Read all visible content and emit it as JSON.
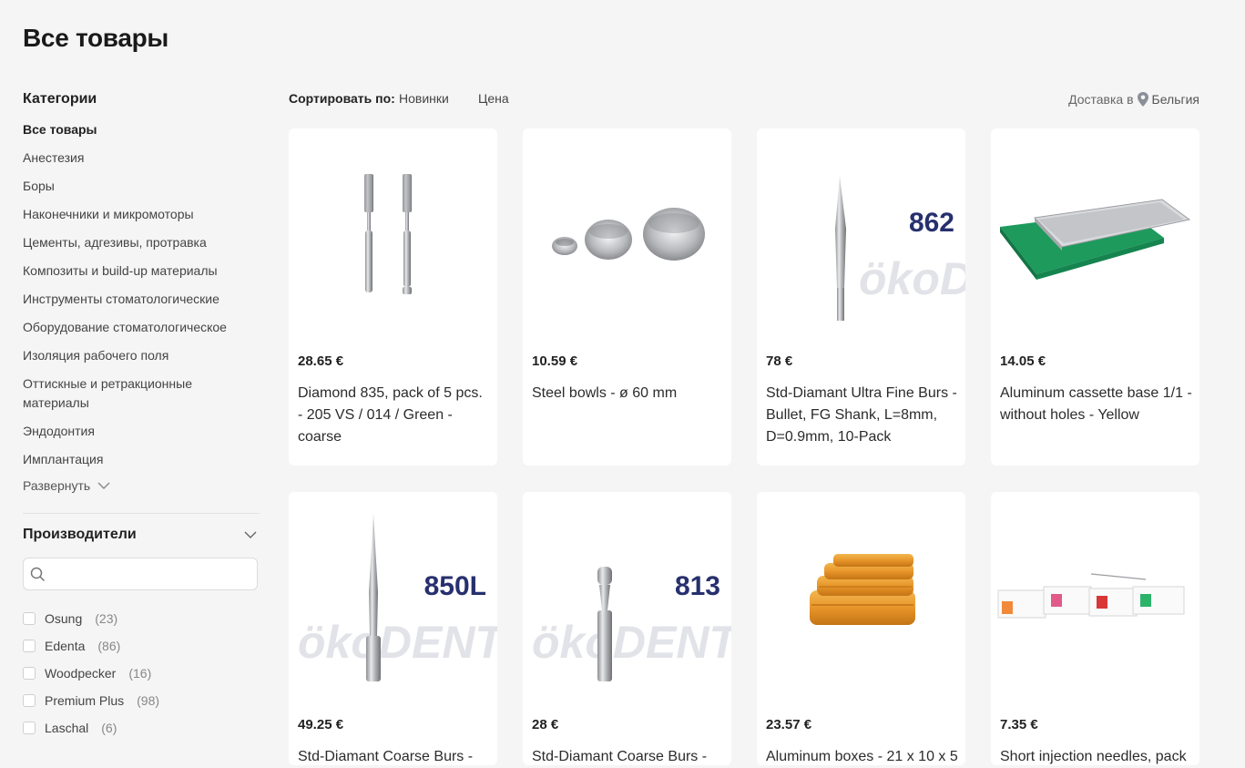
{
  "page": {
    "title": "Все товары"
  },
  "sidebar": {
    "categories_title": "Категории",
    "categories": [
      {
        "label": "Все товары",
        "active": true
      },
      {
        "label": "Анестезия"
      },
      {
        "label": "Боры"
      },
      {
        "label": "Наконечники и микромоторы"
      },
      {
        "label": "Цементы, адгезивы, протравка"
      },
      {
        "label": "Композиты и build-up материалы"
      },
      {
        "label": "Инструменты стоматологические"
      },
      {
        "label": "Оборудование стоматологическое"
      },
      {
        "label": "Изоляция рабочего поля"
      },
      {
        "label": "Оттискные и ретракционные материалы"
      },
      {
        "label": "Эндодонтия"
      },
      {
        "label": "Имплантация"
      }
    ],
    "expand_label": "Развернуть",
    "manufacturers_title": "Производители",
    "search": {
      "placeholder": ""
    },
    "manufacturers": [
      {
        "name": "Osung",
        "count": "(23)"
      },
      {
        "name": "Edenta",
        "count": "(86)"
      },
      {
        "name": "Woodpecker",
        "count": "(16)"
      },
      {
        "name": "Premium Plus",
        "count": "(98)"
      },
      {
        "name": "Laschal",
        "count": "(6)"
      }
    ]
  },
  "toolbar": {
    "sort_label": "Сортировать по:",
    "sort_options": [
      "Новинки",
      "Цена"
    ],
    "delivery_label": "Доставка в",
    "delivery_country": "Бельгия",
    "pin_icon": "location-pin-icon"
  },
  "products": [
    {
      "price": "28.65 €",
      "name": "Diamond 835, pack of 5 pcs. - 205 VS / 014 / Green - coarse",
      "image": "burs-pair"
    },
    {
      "price": "10.59 €",
      "name": "Steel bowls - ø 60 mm",
      "image": "steel-bowls"
    },
    {
      "price": "78 €",
      "name": "Std-Diamant Ultra Fine Burs - Bullet, FG Shank, L=8mm, D=0.9mm, 10-Pack",
      "image": "bur-okodent",
      "badge": "862"
    },
    {
      "price": "14.05 €",
      "name": "Aluminum cassette base 1/1 - without holes - Yellow",
      "image": "cassette-tray"
    },
    {
      "price": "49.25 €",
      "name": "Std-Diamant Coarse Burs -",
      "image": "bur-okodent",
      "badge": "850L"
    },
    {
      "price": "28 €",
      "name": "Std-Diamant Coarse Burs -",
      "image": "bur-okodent",
      "badge": "813"
    },
    {
      "price": "23.57 €",
      "name": "Aluminum boxes - 21 x 10 x 5",
      "image": "aluminum-boxes"
    },
    {
      "price": "7.35 €",
      "name": "Short injection needles, pack",
      "image": "needle-boxes"
    }
  ],
  "watermark": "ökoDENT",
  "colors": {
    "badge": "#27306e",
    "tray_green": "#1d9a5c",
    "box_orange": "#e8962a"
  }
}
